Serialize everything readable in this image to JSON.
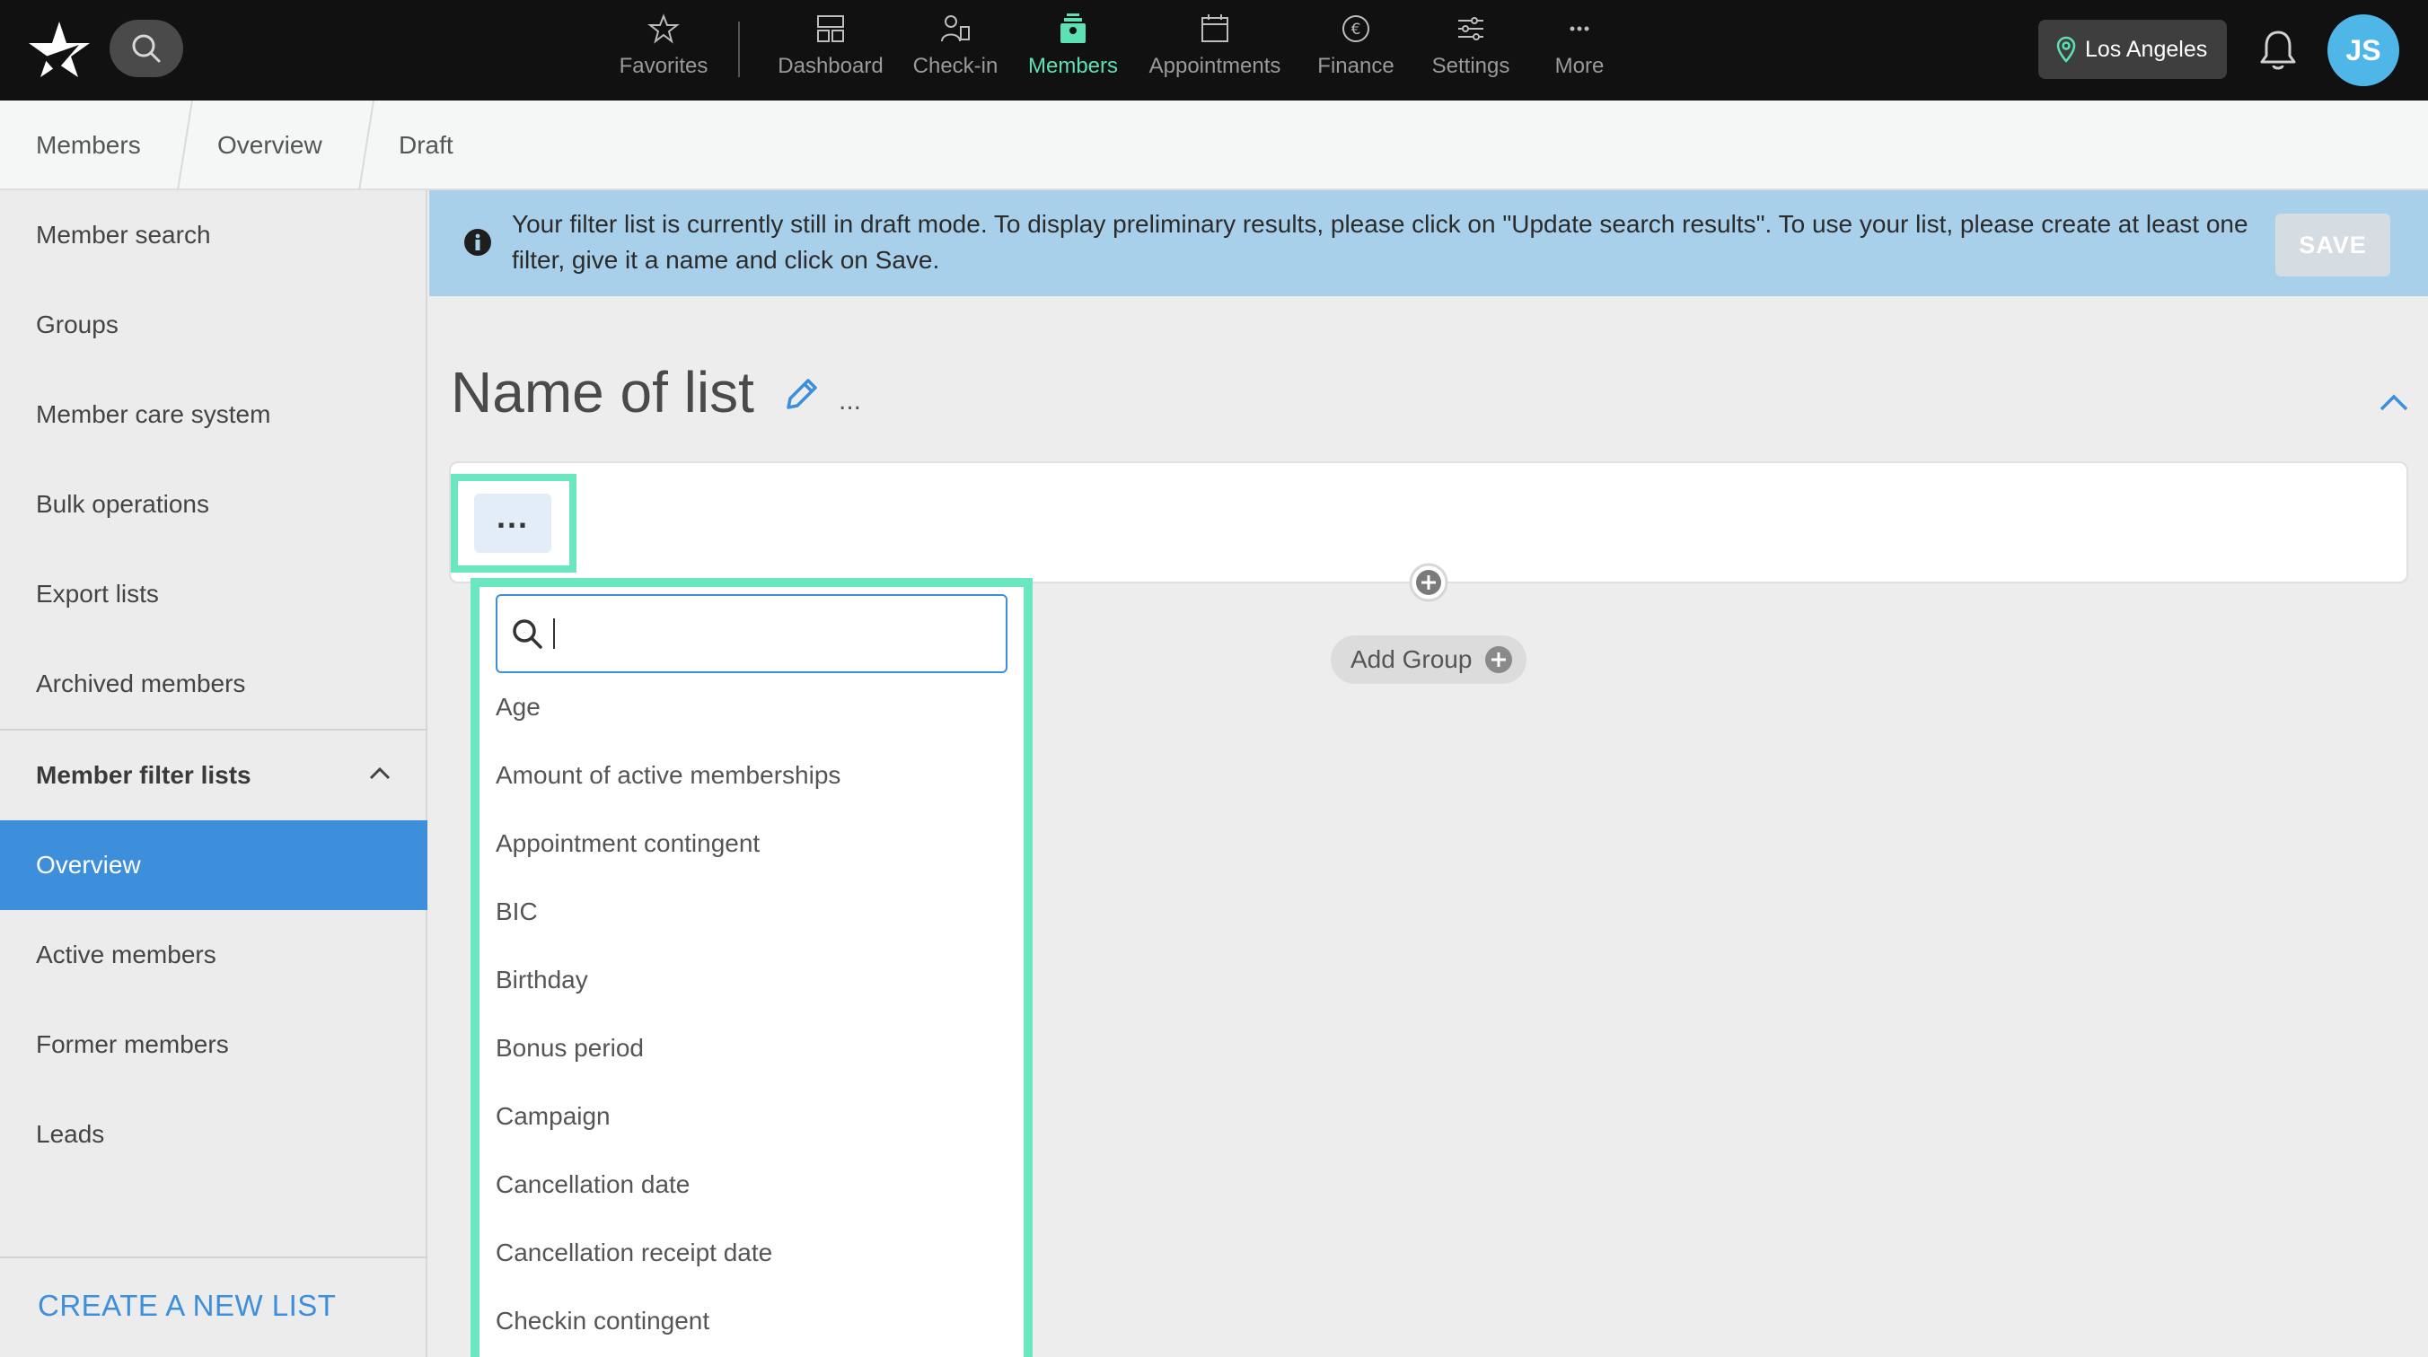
{
  "topbar": {
    "nav": [
      {
        "label": "Favorites",
        "icon": "star-icon"
      },
      {
        "label": "Dashboard",
        "icon": "dashboard-icon"
      },
      {
        "label": "Check-in",
        "icon": "checkin-icon"
      },
      {
        "label": "Members",
        "icon": "members-icon",
        "active": true
      },
      {
        "label": "Appointments",
        "icon": "calendar-icon"
      },
      {
        "label": "Finance",
        "icon": "euro-icon"
      },
      {
        "label": "Settings",
        "icon": "sliders-icon"
      },
      {
        "label": "More",
        "icon": "more-icon"
      }
    ],
    "location": "Los Angeles",
    "avatar_initials": "JS"
  },
  "breadcrumb": [
    "Members",
    "Overview",
    "Draft"
  ],
  "sidebar": {
    "items": [
      "Member search",
      "Groups",
      "Member care system",
      "Bulk operations",
      "Export lists",
      "Archived members"
    ],
    "group_label": "Member filter lists",
    "group_items": [
      "Overview",
      "Active members",
      "Former members",
      "Leads"
    ],
    "create_label": "CREATE A NEW LIST"
  },
  "banner": {
    "text": "Your filter list is currently still in draft mode. To display preliminary results, please click on \"Update search results\". To use your list, please create at least one filter, give it a name and click on Save.",
    "save_label": "SAVE"
  },
  "main": {
    "title": "Name of list",
    "title_more": "...",
    "dots_label": "...",
    "add_group_label": "Add Group"
  },
  "dropdown": {
    "search_value": "",
    "options": [
      "Age",
      "Amount of active memberships",
      "Appointment contingent",
      "BIC",
      "Birthday",
      "Bonus period",
      "Campaign",
      "Cancellation date",
      "Cancellation receipt date",
      "Checkin contingent"
    ]
  },
  "colors": {
    "accent": "#3d8fdc",
    "active_nav": "#5ee0b5",
    "highlight": "#6ae6c0",
    "banner": "#a9d0ea"
  }
}
